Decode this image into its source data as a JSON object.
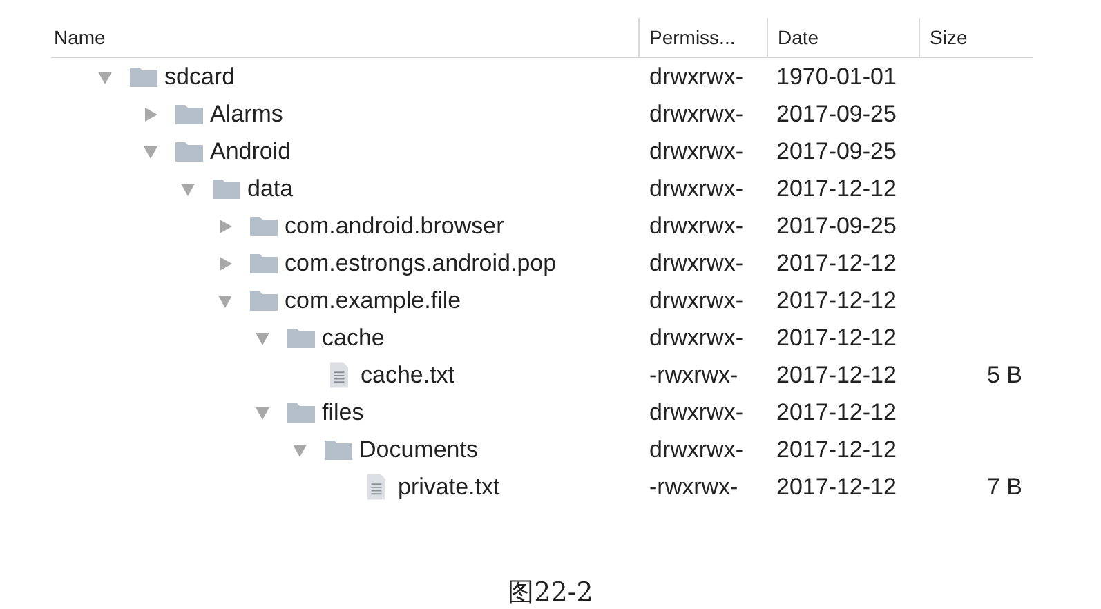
{
  "columns": [
    {
      "label": "Name"
    },
    {
      "label": "Permiss..."
    },
    {
      "label": "Date"
    },
    {
      "label": "Size"
    }
  ],
  "tree": [
    {
      "kind": "folder",
      "name": "sdcard",
      "expanded": true,
      "permissions": "drwxrwx-",
      "date": "1970-01-01",
      "children": [
        {
          "kind": "folder",
          "name": "Alarms",
          "expanded": false,
          "permissions": "drwxrwx-",
          "date": "2017-09-25"
        },
        {
          "kind": "folder",
          "name": "Android",
          "expanded": true,
          "permissions": "drwxrwx-",
          "date": "2017-09-25",
          "children": [
            {
              "kind": "folder",
              "name": "data",
              "expanded": true,
              "permissions": "drwxrwx-",
              "date": "2017-12-12",
              "children": [
                {
                  "kind": "folder",
                  "name": "com.android.browser",
                  "expanded": false,
                  "permissions": "drwxrwx-",
                  "date": "2017-09-25"
                },
                {
                  "kind": "folder",
                  "name": "com.estrongs.android.pop",
                  "expanded": false,
                  "permissions": "drwxrwx-",
                  "date": "2017-12-12"
                },
                {
                  "kind": "folder",
                  "name": "com.example.file",
                  "expanded": true,
                  "permissions": "drwxrwx-",
                  "date": "2017-12-12",
                  "children": [
                    {
                      "kind": "folder",
                      "name": "cache",
                      "expanded": true,
                      "permissions": "drwxrwx-",
                      "date": "2017-12-12",
                      "children": [
                        {
                          "kind": "file",
                          "name": "cache.txt",
                          "permissions": "-rwxrwx-",
                          "date": "2017-12-12",
                          "size": "5 B"
                        }
                      ]
                    },
                    {
                      "kind": "folder",
                      "name": "files",
                      "expanded": true,
                      "permissions": "drwxrwx-",
                      "date": "2017-12-12",
                      "children": [
                        {
                          "kind": "folder",
                          "name": "Documents",
                          "expanded": true,
                          "permissions": "drwxrwx-",
                          "date": "2017-12-12",
                          "children": [
                            {
                              "kind": "file",
                              "name": "private.txt",
                              "permissions": "-rwxrwx-",
                              "date": "2017-12-12",
                              "size": "7 B"
                            }
                          ]
                        }
                      ]
                    }
                  ]
                }
              ]
            }
          ]
        }
      ]
    }
  ],
  "caption": "图22-2"
}
